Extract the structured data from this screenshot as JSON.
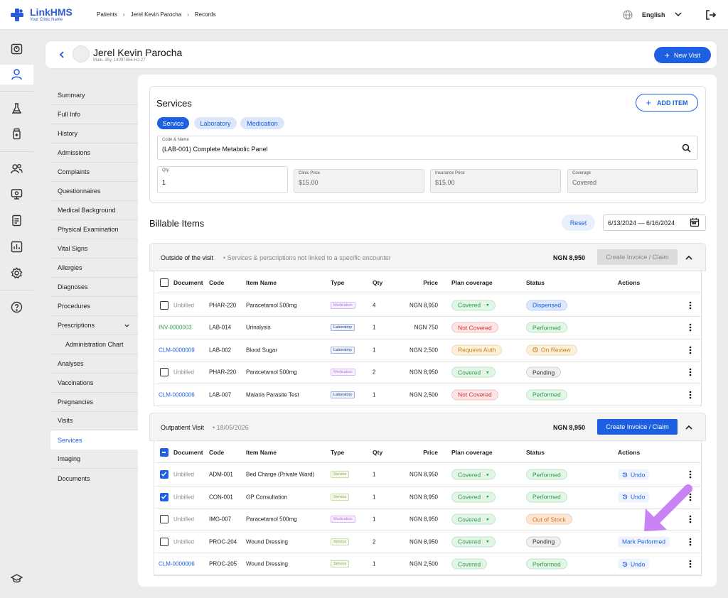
{
  "app": {
    "name": "LinkHMS",
    "tagline": "Your Clinic Name"
  },
  "breadcrumb": [
    "Patients",
    "Jerel Kevin Parocha",
    "Records"
  ],
  "language": "English",
  "patient": {
    "name": "Jerel Kevin Parocha",
    "meta": "Male, 35y, 14097856-HJ-27"
  },
  "new_visit_label": "New Visit",
  "nav": [
    "Summary",
    "Full Info",
    "History",
    "Admissions",
    "Complaints",
    "Questionnaires",
    "Medical Background",
    "Physical Examination",
    "Vital Signs",
    "Allergies",
    "Diagnoses",
    "Procedures",
    "Prescriptions",
    "Administration Chart",
    "Analyses",
    "Vaccinations",
    "Pregnancies",
    "Visits",
    "Services",
    "Imaging",
    "Documents"
  ],
  "services": {
    "title": "Services",
    "add_item": "ADD ITEM",
    "chips": [
      "Service",
      "Laboratory",
      "Medication"
    ],
    "code_label": "Code & Name",
    "code_value": "(LAB-001) Complete Metabolic Panel",
    "qty_label": "Qty",
    "qty_value": "1",
    "clinic_price_label": "Clinic Price",
    "clinic_price_value": "$15.00",
    "insurance_price_label": "Insurance Price",
    "insurance_price_value": "$15.00",
    "coverage_label": "Coverage",
    "coverage_value": "Covered"
  },
  "billable": {
    "title": "Billable Items",
    "reset": "Reset",
    "date_range": "6/13/2024 — 6/16/2024"
  },
  "columns": [
    "Document",
    "Code",
    "Item Name",
    "Type",
    "Qty",
    "Price",
    "Plan coverage",
    "Status",
    "Actions"
  ],
  "group1": {
    "title": "Outside of the visit",
    "subtitle": "Services & perscriptions not linked to a specific encounter",
    "total": "NGN 8,950",
    "button": "Create Invoice / Claim",
    "rows": [
      {
        "doc": "Unbilled",
        "code": "PHAR-220",
        "name": "Paracetamol 500mg",
        "type": "Medication",
        "qty": "4",
        "price": "NGN 8,950",
        "coverage": "Covered",
        "status": "Dispensed",
        "action": ""
      },
      {
        "doc": "INV-0000003",
        "code": "LAB-014",
        "name": "Urinalysis",
        "type": "Laboratory",
        "qty": "1",
        "price": "NGN 750",
        "coverage": "Not Covered",
        "status": "Performed",
        "action": ""
      },
      {
        "doc": "CLM-0000009",
        "code": "LAB-002",
        "name": "Blood Sugar",
        "type": "Laboratory",
        "qty": "1",
        "price": "NGN 2,500",
        "coverage": "Requires Auth",
        "status": "On Review",
        "action": ""
      },
      {
        "doc": "Unbilled",
        "code": "PHAR-220",
        "name": "Paracetamol 500mg",
        "type": "Medication",
        "qty": "2",
        "price": "NGN 8,950",
        "coverage": "Covered",
        "status": "Pending",
        "action": ""
      },
      {
        "doc": "CLM-0000006",
        "code": "LAB-007",
        "name": "Malaria Parasite Test",
        "type": "Laboratory",
        "qty": "1",
        "price": "NGN 2,500",
        "coverage": "Not Covered",
        "status": "Performed",
        "action": ""
      }
    ]
  },
  "group2": {
    "title": "Outpatient Visit",
    "subtitle": "18/05/2026",
    "total": "NGN 8,950",
    "button": "Create Invoice / Claim",
    "rows": [
      {
        "doc": "Unbilled",
        "code": "ADM-001",
        "name": "Bed Charge (Private Ward)",
        "type": "Service",
        "qty": "1",
        "price": "NGN 8,950",
        "coverage": "Covered",
        "status": "Performed",
        "action": "Undo"
      },
      {
        "doc": "Unbilled",
        "code": "CON-001",
        "name": "GP Consultation",
        "type": "Service",
        "qty": "1",
        "price": "NGN 8,950",
        "coverage": "Covered",
        "status": "Performed",
        "action": "Undo"
      },
      {
        "doc": "Unbilled",
        "code": "IMG-007",
        "name": "Paracetamol 500mg",
        "type": "Medication",
        "qty": "1",
        "price": "NGN 8,950",
        "coverage": "Covered",
        "status": "Out of Stock",
        "action": ""
      },
      {
        "doc": "Unbilled",
        "code": "PROC-204",
        "name": "Wound Dressing",
        "type": "Service",
        "qty": "2",
        "price": "NGN 8,950",
        "coverage": "Covered",
        "status": "Pending",
        "action": "Mark Performed"
      },
      {
        "doc": "CLM-0000006",
        "code": "PROC-205",
        "name": "Wound Dressing",
        "type": "Service",
        "qty": "1",
        "price": "NGN 2,500",
        "coverage": "Covered",
        "status": "Performed",
        "action": "Undo"
      }
    ]
  },
  "colors": {
    "primary": "#1c5fe0",
    "green": "#2e9e4a",
    "red": "#d33030",
    "orange": "#d98a1c",
    "purple": "#b774ee"
  }
}
